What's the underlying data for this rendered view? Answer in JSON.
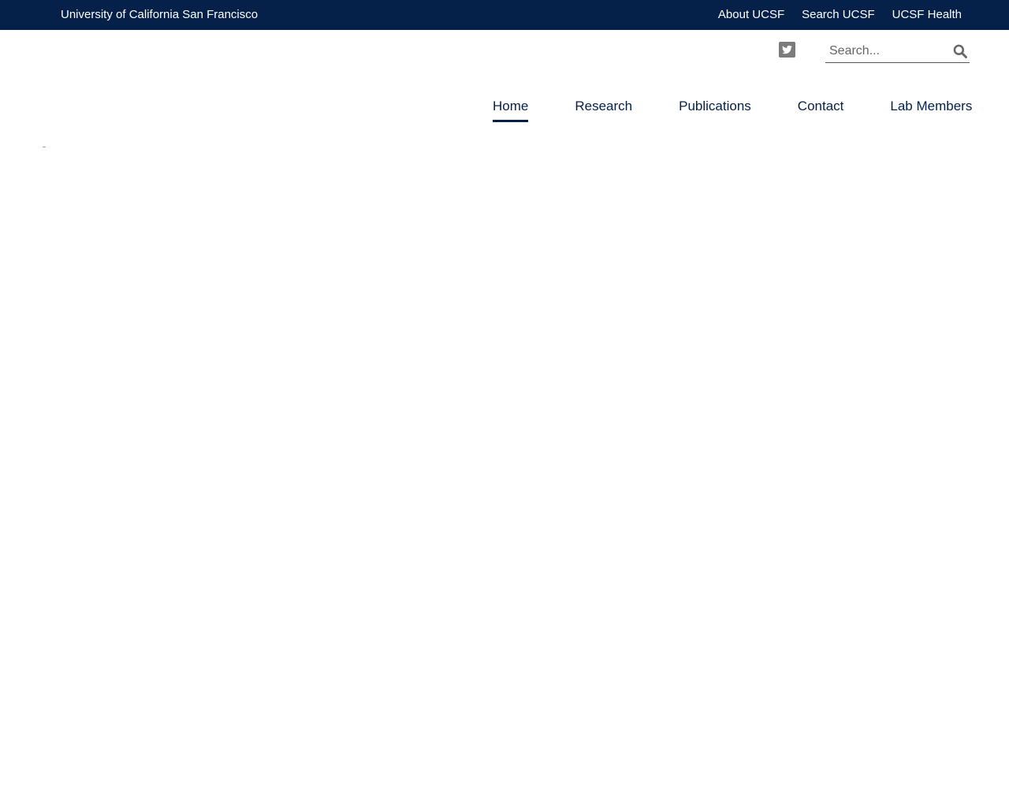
{
  "colors": {
    "topbar_background": "#052049",
    "topbar_text": "#ffffff",
    "nav_text": "#052049",
    "icon_gray": "#7b7b7b"
  },
  "topbar": {
    "university_name": "University of California San Francisco",
    "links": [
      "About UCSF",
      "Search UCSF",
      "UCSF Health"
    ]
  },
  "header": {
    "social": {
      "icon": "twitter-icon"
    },
    "search": {
      "placeholder": "Search...",
      "icon": "search-icon"
    }
  },
  "navigation": {
    "items": [
      "Home",
      "Research",
      "Publications",
      "Contact",
      "Lab Members"
    ],
    "active": "Home"
  }
}
